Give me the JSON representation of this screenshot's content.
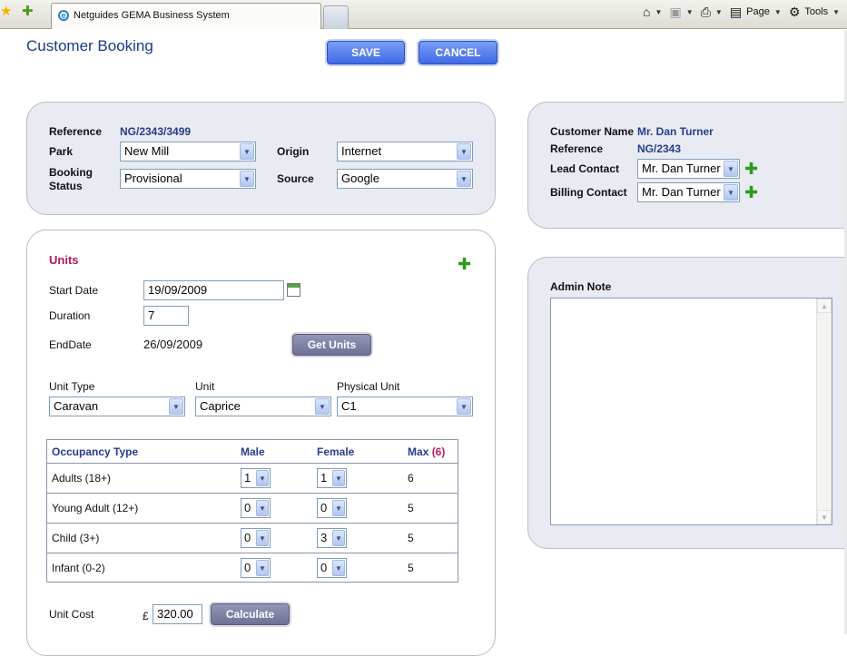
{
  "browser": {
    "tab_title": "Netguides GEMA Business System",
    "toolbar": {
      "page_label": "Page",
      "tools_label": "Tools"
    }
  },
  "page": {
    "title": "Customer Booking",
    "save_label": "SAVE",
    "cancel_label": "CANCEL"
  },
  "booking": {
    "reference_label": "Reference",
    "reference_value": "NG/2343/3499",
    "park_label": "Park",
    "park_value": "New Mill",
    "origin_label": "Origin",
    "origin_value": "Internet",
    "status_label_1": "Booking",
    "status_label_2": "Status",
    "status_value": "Provisional",
    "source_label": "Source",
    "source_value": "Google"
  },
  "customer": {
    "name_label": "Customer Name",
    "name_value": "Mr. Dan Turner",
    "reference_label": "Reference",
    "reference_value": "NG/2343",
    "lead_label": "Lead Contact",
    "lead_value": "Mr. Dan Turner",
    "billing_label": "Billing Contact",
    "billing_value": "Mr. Dan Turner"
  },
  "admin": {
    "note_label": "Admin Note",
    "note_value": ""
  },
  "units": {
    "title": "Units",
    "start_label": "Start Date",
    "start_value": "19/09/2009",
    "duration_label": "Duration",
    "duration_value": "7",
    "end_label": "EndDate",
    "end_value": "26/09/2009",
    "get_units_label": "Get Units",
    "unit_type_label": "Unit Type",
    "unit_type_value": "Caravan",
    "unit_label": "Unit",
    "unit_value": "Caprice",
    "physical_label": "Physical Unit",
    "physical_value": "C1",
    "unit_cost_label": "Unit Cost",
    "currency": "£",
    "unit_cost_value": "320.00",
    "calculate_label": "Calculate"
  },
  "occupancy": {
    "headers": {
      "type": "Occupancy Type",
      "male": "Male",
      "female": "Female",
      "max": "Max",
      "max_total": "(6)"
    },
    "rows": [
      {
        "type": "Adults (18+)",
        "male": "1",
        "female": "1",
        "max": "6"
      },
      {
        "type": "Young Adult (12+)",
        "male": "0",
        "female": "0",
        "max": "5"
      },
      {
        "type": "Child (3+)",
        "male": "0",
        "female": "3",
        "max": "5"
      },
      {
        "type": "Infant (0-2)",
        "male": "0",
        "female": "0",
        "max": "5"
      }
    ]
  },
  "colors": {
    "accent": "#4a74ea",
    "heading": "#1a3b8b",
    "units_title": "#b3165e",
    "panel_bg": "#e8ebf2"
  }
}
